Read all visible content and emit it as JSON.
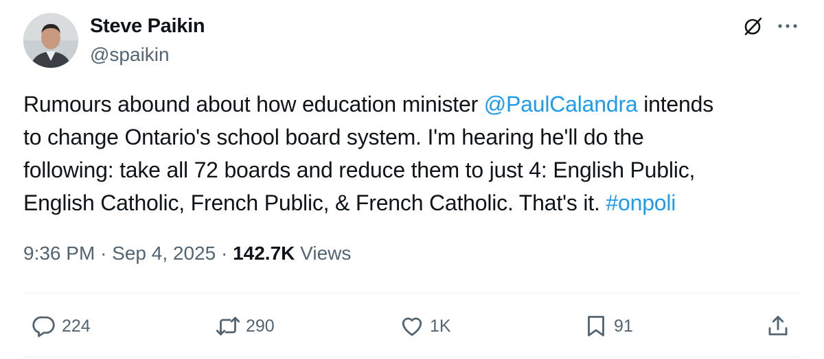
{
  "author": {
    "display_name": "Steve Paikin",
    "handle": "@spaikin"
  },
  "tweet": {
    "lines": [
      [
        {
          "text": "Rumours abound about how education minister "
        },
        {
          "text": "@PaulCalandra",
          "link": true
        },
        {
          "text": " intends"
        }
      ],
      [
        {
          "text": "to change Ontario's school board system. I'm hearing he'll do the"
        }
      ],
      [
        {
          "text": "following: take all 72 boards and reduce them to just 4: English Public,"
        }
      ],
      [
        {
          "text": "English Catholic, French Public, & French Catholic. That's it. "
        },
        {
          "text": "#onpoli",
          "link": true
        }
      ]
    ]
  },
  "meta": {
    "time": "9:36 PM",
    "separator": "·",
    "date": "Sep 4, 2025",
    "views_count": "142.7K",
    "views_label": "Views"
  },
  "actions": {
    "replies": "224",
    "reposts": "290",
    "likes": "1K",
    "bookmarks": "91"
  },
  "icons": {
    "grok": "grok-icon",
    "more": "more-icon",
    "reply": "reply-icon",
    "repost": "repost-icon",
    "like": "heart-icon",
    "bookmark": "bookmark-icon",
    "share": "share-icon"
  },
  "colors": {
    "link": "#1d9bf0",
    "secondary_text": "#536471",
    "primary_text": "#0f1419"
  }
}
